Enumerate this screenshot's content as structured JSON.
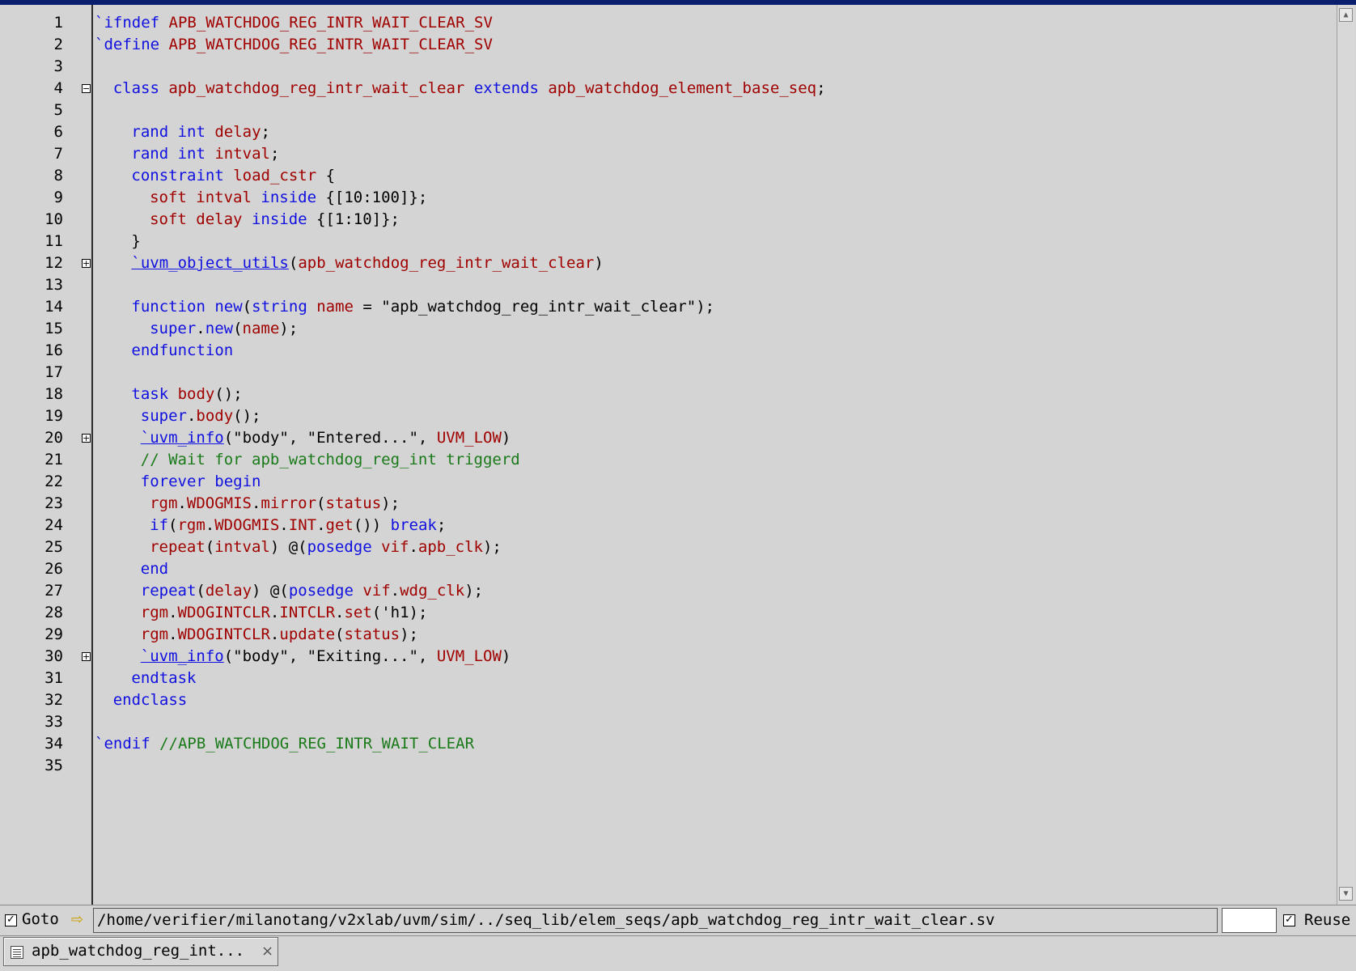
{
  "editor": {
    "lines": [
      {
        "n": "1",
        "fold": "",
        "indent": 0,
        "tokens": [
          [
            "kw",
            "`ifndef "
          ],
          [
            "id",
            "APB_WATCHDOG_REG_INTR_WAIT_CLEAR_SV"
          ]
        ]
      },
      {
        "n": "2",
        "fold": "",
        "indent": 0,
        "tokens": [
          [
            "kw",
            "`define "
          ],
          [
            "id",
            "APB_WATCHDOG_REG_INTR_WAIT_CLEAR_SV"
          ]
        ]
      },
      {
        "n": "3",
        "fold": "",
        "indent": 0,
        "tokens": []
      },
      {
        "n": "4",
        "fold": "minus",
        "indent": 2,
        "tokens": [
          [
            "kw",
            "class "
          ],
          [
            "id",
            "apb_watchdog_reg_intr_wait_clear "
          ],
          [
            "kw",
            "extends "
          ],
          [
            "id",
            "apb_watchdog_element_base_seq"
          ],
          [
            "tx",
            ";"
          ]
        ]
      },
      {
        "n": "5",
        "fold": "",
        "indent": 0,
        "tokens": []
      },
      {
        "n": "6",
        "fold": "",
        "indent": 4,
        "tokens": [
          [
            "kw",
            "rand int "
          ],
          [
            "id",
            "delay"
          ],
          [
            "tx",
            ";"
          ]
        ]
      },
      {
        "n": "7",
        "fold": "",
        "indent": 4,
        "tokens": [
          [
            "kw",
            "rand int "
          ],
          [
            "id",
            "intval"
          ],
          [
            "tx",
            ";"
          ]
        ]
      },
      {
        "n": "8",
        "fold": "",
        "indent": 4,
        "tokens": [
          [
            "kw",
            "constraint "
          ],
          [
            "id",
            "load_cstr "
          ],
          [
            "tx",
            "{"
          ]
        ]
      },
      {
        "n": "9",
        "fold": "",
        "indent": 6,
        "tokens": [
          [
            "id",
            "soft intval "
          ],
          [
            "kw",
            "inside "
          ],
          [
            "tx",
            "{[10:100]};"
          ]
        ]
      },
      {
        "n": "10",
        "fold": "",
        "indent": 6,
        "tokens": [
          [
            "id",
            "soft delay "
          ],
          [
            "kw",
            "inside "
          ],
          [
            "tx",
            "{[1:10]};"
          ]
        ]
      },
      {
        "n": "11",
        "fold": "",
        "indent": 4,
        "tokens": [
          [
            "tx",
            "}"
          ]
        ]
      },
      {
        "n": "12",
        "fold": "plus",
        "indent": 4,
        "tokens": [
          [
            "mac",
            "`uvm_object_utils"
          ],
          [
            "tx",
            "("
          ],
          [
            "id",
            "apb_watchdog_reg_intr_wait_clear"
          ],
          [
            "tx",
            ")"
          ]
        ]
      },
      {
        "n": "13",
        "fold": "",
        "indent": 0,
        "tokens": []
      },
      {
        "n": "14",
        "fold": "",
        "indent": 4,
        "tokens": [
          [
            "kw",
            "function new"
          ],
          [
            "tx",
            "("
          ],
          [
            "kw",
            "string "
          ],
          [
            "id",
            "name "
          ],
          [
            "tx",
            "= \"apb_watchdog_reg_intr_wait_clear\");"
          ]
        ]
      },
      {
        "n": "15",
        "fold": "",
        "indent": 6,
        "tokens": [
          [
            "kw",
            "super"
          ],
          [
            "tx",
            "."
          ],
          [
            "kw",
            "new"
          ],
          [
            "tx",
            "("
          ],
          [
            "id",
            "name"
          ],
          [
            "tx",
            ");"
          ]
        ]
      },
      {
        "n": "16",
        "fold": "",
        "indent": 4,
        "tokens": [
          [
            "kw",
            "endfunction"
          ]
        ]
      },
      {
        "n": "17",
        "fold": "",
        "indent": 0,
        "tokens": []
      },
      {
        "n": "18",
        "fold": "",
        "indent": 4,
        "tokens": [
          [
            "kw",
            "task "
          ],
          [
            "id",
            "body"
          ],
          [
            "tx",
            "();"
          ]
        ]
      },
      {
        "n": "19",
        "fold": "",
        "indent": 5,
        "tokens": [
          [
            "kw",
            "super"
          ],
          [
            "tx",
            "."
          ],
          [
            "id",
            "body"
          ],
          [
            "tx",
            "();"
          ]
        ]
      },
      {
        "n": "20",
        "fold": "plus",
        "indent": 5,
        "tokens": [
          [
            "mac",
            "`uvm_info"
          ],
          [
            "tx",
            "(\"body\", \"Entered...\", "
          ],
          [
            "id",
            "UVM_LOW"
          ],
          [
            "tx",
            ")"
          ]
        ]
      },
      {
        "n": "21",
        "fold": "",
        "indent": 5,
        "tokens": [
          [
            "cm",
            "// Wait for apb_watchdog_reg_int triggerd"
          ]
        ]
      },
      {
        "n": "22",
        "fold": "",
        "indent": 5,
        "tokens": [
          [
            "kw",
            "forever begin"
          ]
        ]
      },
      {
        "n": "23",
        "fold": "",
        "indent": 6,
        "tokens": [
          [
            "id",
            "rgm"
          ],
          [
            "tx",
            "."
          ],
          [
            "id",
            "WDOGMIS"
          ],
          [
            "tx",
            "."
          ],
          [
            "id",
            "mirror"
          ],
          [
            "tx",
            "("
          ],
          [
            "id",
            "status"
          ],
          [
            "tx",
            ");"
          ]
        ]
      },
      {
        "n": "24",
        "fold": "",
        "indent": 6,
        "tokens": [
          [
            "kw",
            "if"
          ],
          [
            "tx",
            "("
          ],
          [
            "id",
            "rgm"
          ],
          [
            "tx",
            "."
          ],
          [
            "id",
            "WDOGMIS"
          ],
          [
            "tx",
            "."
          ],
          [
            "id",
            "INT"
          ],
          [
            "tx",
            "."
          ],
          [
            "id",
            "get"
          ],
          [
            "tx",
            "()) "
          ],
          [
            "kw",
            "break"
          ],
          [
            "tx",
            ";"
          ]
        ]
      },
      {
        "n": "25",
        "fold": "",
        "indent": 6,
        "tokens": [
          [
            "id",
            "repeat"
          ],
          [
            "tx",
            "("
          ],
          [
            "id",
            "intval"
          ],
          [
            "tx",
            ") @("
          ],
          [
            "kw",
            "posedge "
          ],
          [
            "id",
            "vif"
          ],
          [
            "tx",
            "."
          ],
          [
            "id",
            "apb_clk"
          ],
          [
            "tx",
            ");"
          ]
        ]
      },
      {
        "n": "26",
        "fold": "",
        "indent": 5,
        "tokens": [
          [
            "kw",
            "end"
          ]
        ]
      },
      {
        "n": "27",
        "fold": "",
        "indent": 5,
        "tokens": [
          [
            "kw",
            "repeat"
          ],
          [
            "tx",
            "("
          ],
          [
            "id",
            "delay"
          ],
          [
            "tx",
            ") @("
          ],
          [
            "kw",
            "posedge "
          ],
          [
            "id",
            "vif"
          ],
          [
            "tx",
            "."
          ],
          [
            "id",
            "wdg_clk"
          ],
          [
            "tx",
            ");"
          ]
        ]
      },
      {
        "n": "28",
        "fold": "",
        "indent": 5,
        "tokens": [
          [
            "id",
            "rgm"
          ],
          [
            "tx",
            "."
          ],
          [
            "id",
            "WDOGINTCLR"
          ],
          [
            "tx",
            "."
          ],
          [
            "id",
            "INTCLR"
          ],
          [
            "tx",
            "."
          ],
          [
            "id",
            "set"
          ],
          [
            "tx",
            "('h1);"
          ]
        ]
      },
      {
        "n": "29",
        "fold": "",
        "indent": 5,
        "tokens": [
          [
            "id",
            "rgm"
          ],
          [
            "tx",
            "."
          ],
          [
            "id",
            "WDOGINTCLR"
          ],
          [
            "tx",
            "."
          ],
          [
            "id",
            "update"
          ],
          [
            "tx",
            "("
          ],
          [
            "id",
            "status"
          ],
          [
            "tx",
            ");"
          ]
        ]
      },
      {
        "n": "30",
        "fold": "plus",
        "indent": 5,
        "tokens": [
          [
            "mac",
            "`uvm_info"
          ],
          [
            "tx",
            "(\"body\", \"Exiting...\", "
          ],
          [
            "id",
            "UVM_LOW"
          ],
          [
            "tx",
            ")"
          ]
        ]
      },
      {
        "n": "31",
        "fold": "",
        "indent": 4,
        "tokens": [
          [
            "kw",
            "endtask"
          ]
        ]
      },
      {
        "n": "32",
        "fold": "",
        "indent": 2,
        "tokens": [
          [
            "kw",
            "endclass"
          ]
        ]
      },
      {
        "n": "33",
        "fold": "",
        "indent": 0,
        "tokens": []
      },
      {
        "n": "34",
        "fold": "",
        "indent": 0,
        "tokens": [
          [
            "kw",
            "`endif "
          ],
          [
            "cm",
            "//APB_WATCHDOG_REG_INTR_WAIT_CLEAR"
          ]
        ]
      },
      {
        "n": "35",
        "fold": "",
        "indent": 0,
        "tokens": []
      }
    ]
  },
  "statusbar": {
    "goto_checked": true,
    "goto_label": "Goto",
    "goto_icon": "arrow-right-icon",
    "path": "/home/verifier/milanotang/v2xlab/uvm/sim/../seq_lib/elem_seqs/apb_watchdog_reg_intr_wait_clear.sv",
    "small_field": "",
    "reuse_checked": true,
    "reuse_label": "Reuse"
  },
  "tabs": [
    {
      "label": "apb_watchdog_reg_int...",
      "icon": "document-icon",
      "close": "×"
    }
  ],
  "colors": {
    "background": "#d4d4d4",
    "keyword": "#1010e0",
    "identifier": "#a00000",
    "comment": "#1a7a1a",
    "title_bar": "#0a1e6e"
  }
}
